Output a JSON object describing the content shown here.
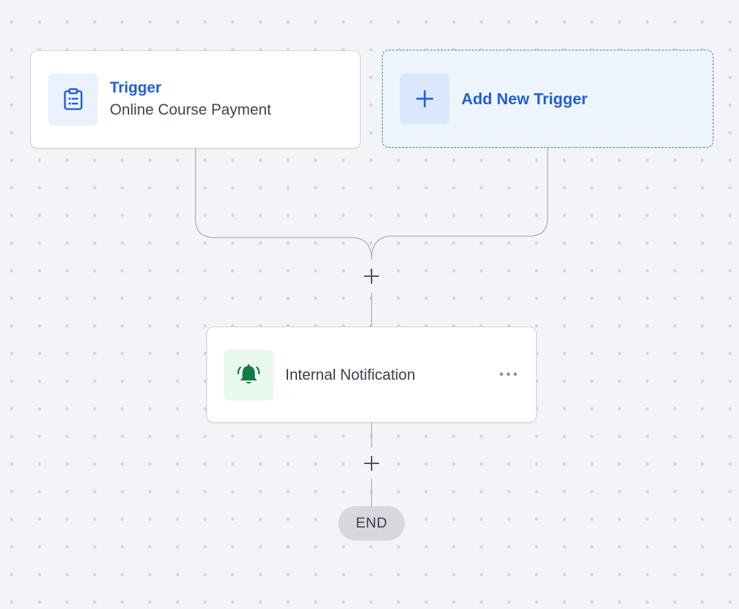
{
  "trigger_card": {
    "title": "Trigger",
    "subtitle": "Online Course Payment",
    "icon": "clipboard-list-icon"
  },
  "add_trigger_card": {
    "label": "Add New Trigger",
    "icon": "plus-icon"
  },
  "action_card": {
    "label": "Internal Notification",
    "icon": "bell-ringing-icon",
    "menu_icon": "more-horizontal-icon"
  },
  "end_node": {
    "label": "END"
  },
  "colors": {
    "accent": "#1f5fd8",
    "notification_green": "#137a4a",
    "connector": "#b5b8bf",
    "canvas_bg": "#f3f4f7"
  }
}
